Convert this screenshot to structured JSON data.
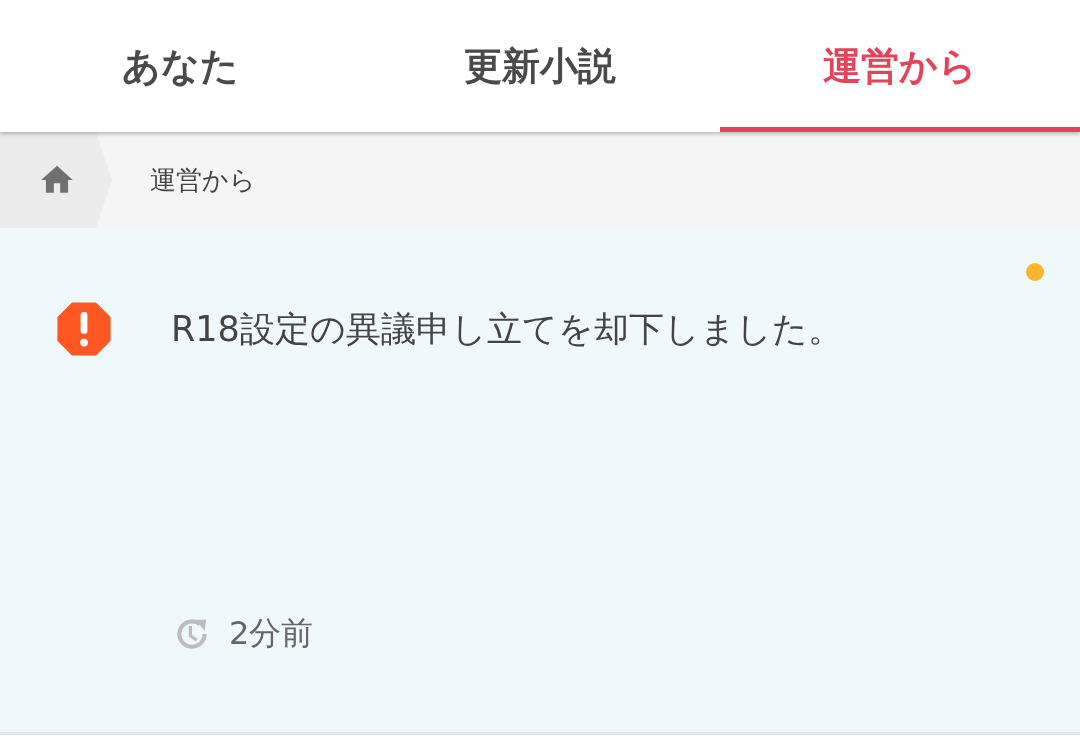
{
  "tabs": [
    {
      "label": "あなた",
      "selected": false
    },
    {
      "label": "更新小説",
      "selected": false
    },
    {
      "label": "運営から",
      "selected": true
    }
  ],
  "breadcrumb": {
    "current": "運営から"
  },
  "notification": {
    "message": "R18設定の異議申し立てを却下しました。",
    "time": "2分前",
    "unread": true
  }
}
